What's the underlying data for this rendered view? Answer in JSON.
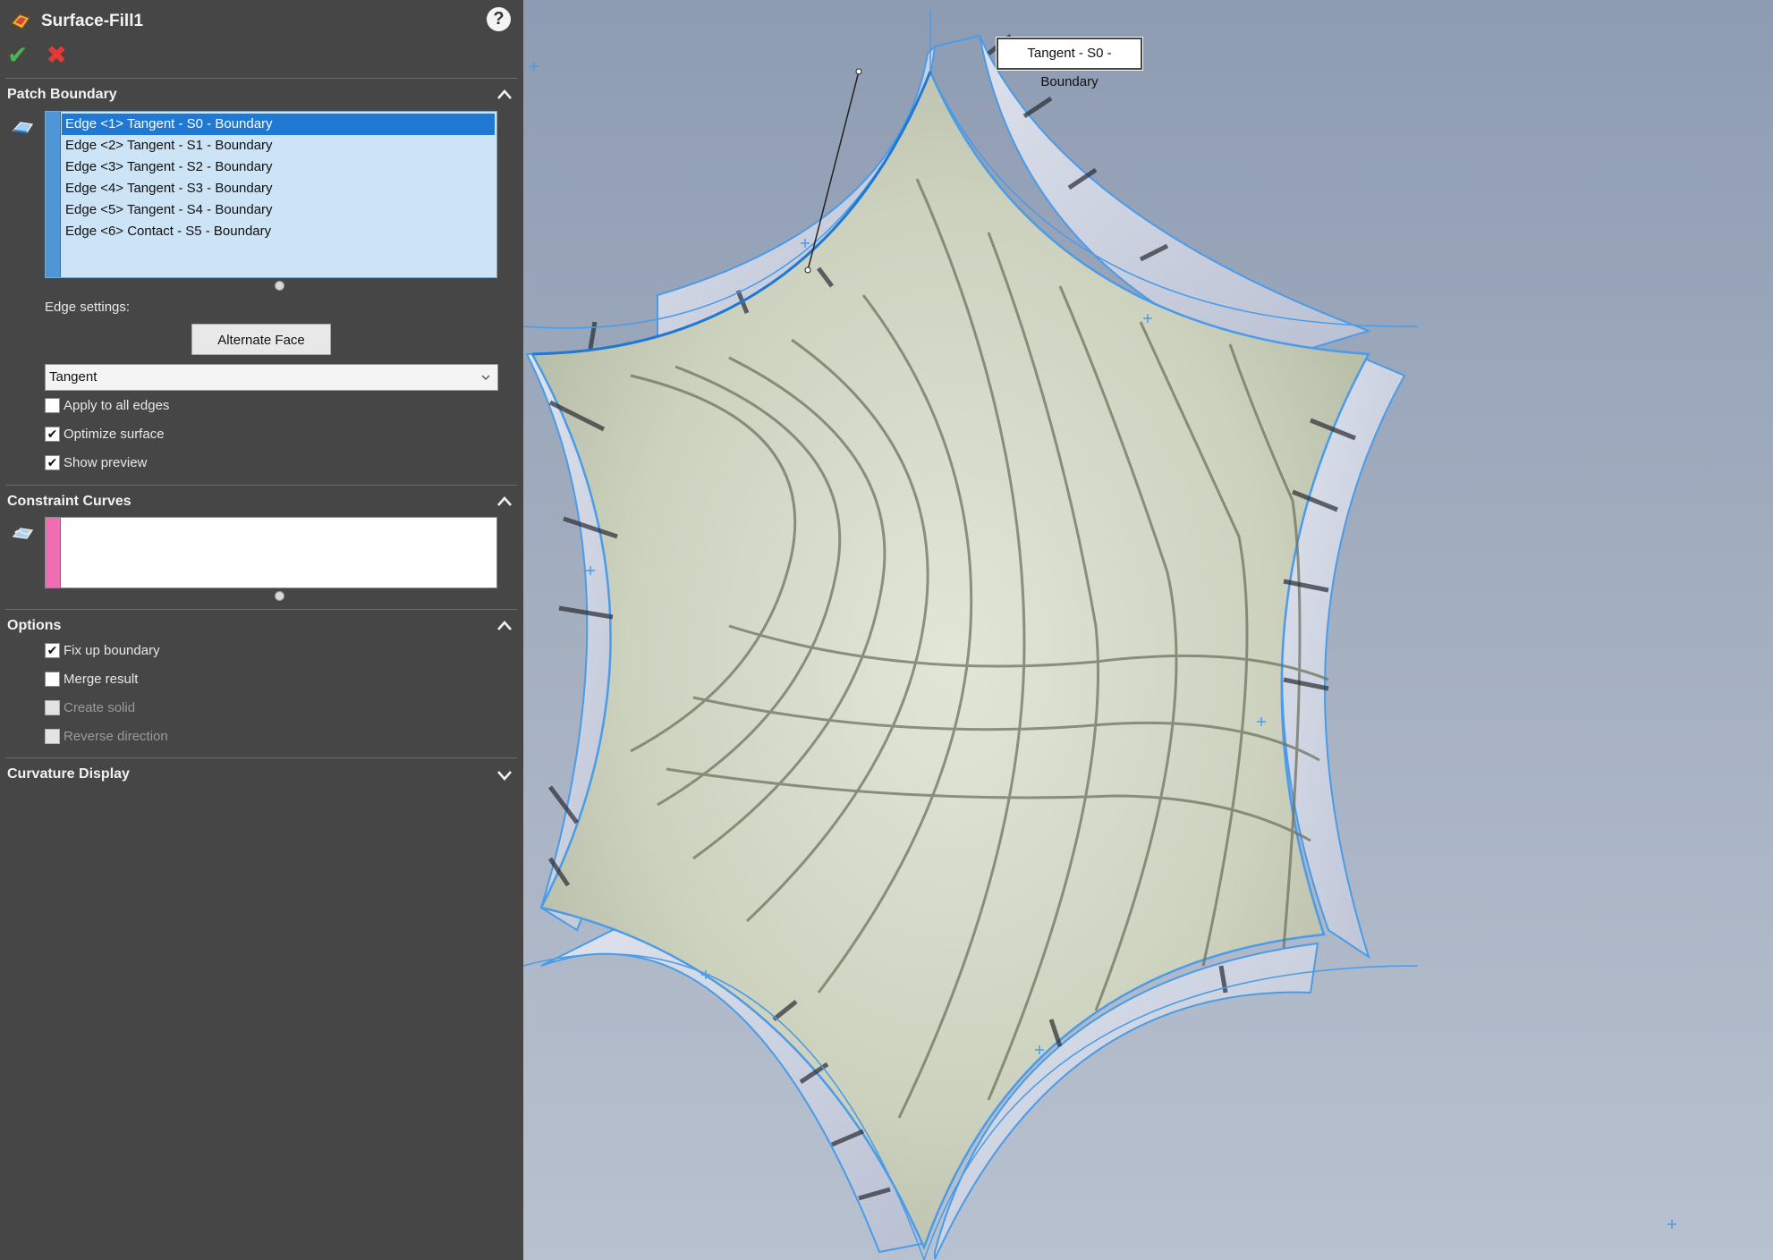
{
  "feature": {
    "title": "Surface-Fill1",
    "icon": "surface-fill-icon"
  },
  "toolbar": {
    "help_icon": "?",
    "ok_icon": "✔",
    "cancel_icon": "✖"
  },
  "patch_boundary": {
    "heading": "Patch Boundary",
    "edges": [
      "Edge <1> Tangent - S0 - Boundary",
      "Edge <2> Tangent - S1 - Boundary",
      "Edge <3> Tangent - S2 - Boundary",
      "Edge <4> Tangent - S3 - Boundary",
      "Edge <5> Tangent - S4 - Boundary",
      "Edge <6> Contact - S5 - Boundary"
    ],
    "selected_index": 0,
    "edge_settings_label": "Edge settings:",
    "alternate_face_label": "Alternate Face",
    "condition_value": "Tangent",
    "apply_all_label": "Apply to all edges",
    "apply_all_checked": false,
    "optimize_label": "Optimize surface",
    "optimize_checked": true,
    "show_preview_label": "Show preview",
    "show_preview_checked": true
  },
  "constraint_curves": {
    "heading": "Constraint Curves"
  },
  "options": {
    "heading": "Options",
    "fix_up_label": "Fix up boundary",
    "fix_up_checked": true,
    "merge_label": "Merge result",
    "merge_checked": false,
    "create_solid_label": "Create solid",
    "create_solid_checked": false,
    "reverse_label": "Reverse direction",
    "reverse_checked": false
  },
  "curvature_display": {
    "heading": "Curvature Display"
  },
  "viewport": {
    "callout": "Tangent - S0 - Boundary"
  },
  "colors": {
    "panel_bg": "#464646",
    "list_bg": "#cde3f6",
    "selection": "#1f78d1",
    "edge_highlight": "#4a9be8",
    "surface": "#cfd5c3",
    "constraint_stripe": "#f06cb3"
  }
}
